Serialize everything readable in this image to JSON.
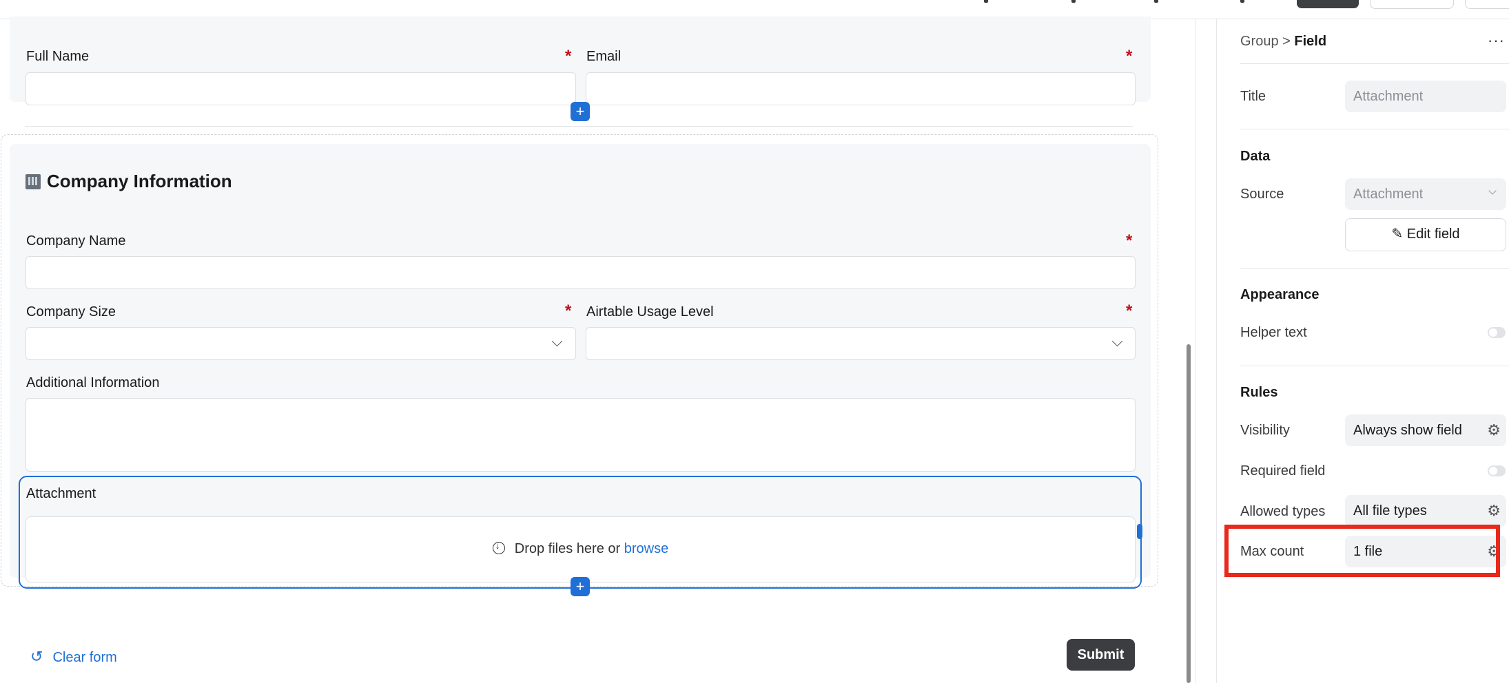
{
  "form": {
    "full_name_label": "Full Name",
    "email_label": "Email",
    "required_marker": "*",
    "section_title": "Company Information",
    "company_name_label": "Company Name",
    "company_size_label": "Company Size",
    "usage_level_label": "Airtable Usage Level",
    "additional_info_label": "Additional Information",
    "attachment_label": "Attachment",
    "drop_text": "Drop files here or",
    "browse_link": "browse",
    "add_symbol": "+",
    "clear_form": "Clear form",
    "submit": "Submit"
  },
  "panel": {
    "breadcrumb_parent": "Group",
    "breadcrumb_sep": ">",
    "breadcrumb_current": "Field",
    "more": "···",
    "title_label": "Title",
    "title_value": "Attachment",
    "data_heading": "Data",
    "source_label": "Source",
    "source_value": "Attachment",
    "edit_field": "Edit field",
    "appearance_heading": "Appearance",
    "helper_text_label": "Helper text",
    "rules_heading": "Rules",
    "visibility_label": "Visibility",
    "visibility_value": "Always show field",
    "required_label": "Required field",
    "allowed_types_label": "Allowed types",
    "allowed_types_value": "All file types",
    "max_count_label": "Max count",
    "max_count_value": "1 file"
  },
  "icons": {
    "gear": "gear-icon",
    "pencil": "pencil-icon",
    "chevron": "chevron-down-icon",
    "download": "download-circle-icon",
    "reset": "reset-icon",
    "building": "building-icon"
  },
  "colors": {
    "accent": "#1f6fd6",
    "required": "#c1121f",
    "highlight": "#e8291c",
    "submit_bg": "#3c3d40"
  }
}
